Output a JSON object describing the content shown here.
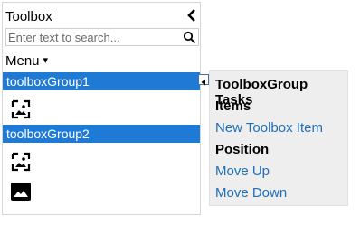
{
  "toolbox": {
    "title": "Toolbox",
    "search_placeholder": "Enter text to search...",
    "menu_label": "Menu",
    "menu_caret": "▾",
    "groups": [
      {
        "label": "toolboxGroup1",
        "items": [
          "image-tool-icon"
        ]
      },
      {
        "label": "toolboxGroup2",
        "items": [
          "image-tool-icon",
          "image-filled-icon"
        ]
      }
    ]
  },
  "tasks_panel": {
    "title": "ToolboxGroup Tasks",
    "sections": [
      {
        "header": "Items",
        "links": [
          "New Toolbox Item"
        ]
      },
      {
        "header": "Position",
        "links": [
          "Move Up",
          "Move Down"
        ]
      }
    ]
  },
  "colors": {
    "group_header_bg": "#1f7ad6",
    "link": "#1e6fb9",
    "panel_bg": "#eeeeee"
  }
}
